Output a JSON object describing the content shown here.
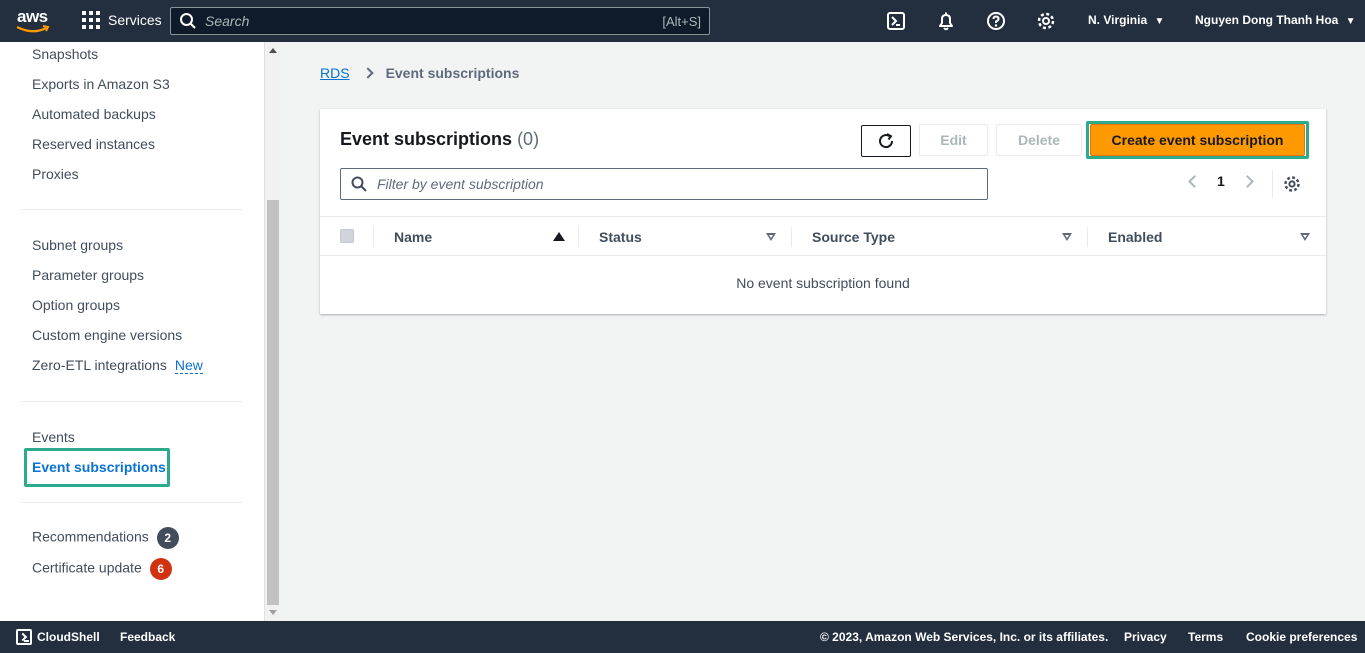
{
  "topnav": {
    "logo": "aws",
    "services_label": "Services",
    "search_placeholder": "Search",
    "search_shortcut": "[Alt+S]",
    "region": "N. Virginia",
    "user": "Nguyen Dong Thanh Hoa",
    "icons": [
      "cloudshell-icon",
      "notifications-icon",
      "help-icon",
      "settings-icon"
    ]
  },
  "sidebar": {
    "group1": [
      "Snapshots",
      "Exports in Amazon S3",
      "Automated backups",
      "Reserved instances",
      "Proxies"
    ],
    "group2": [
      "Subnet groups",
      "Parameter groups",
      "Option groups",
      "Custom engine versions",
      "Zero-ETL integrations"
    ],
    "new_label": "New",
    "group3": [
      "Events",
      "Event subscriptions"
    ],
    "group4": [
      {
        "label": "Recommendations",
        "count": "2"
      },
      {
        "label": "Certificate update",
        "count": "6"
      }
    ]
  },
  "breadcrumb": {
    "root": "RDS",
    "current": "Event subscriptions"
  },
  "panel": {
    "title": "Event subscriptions",
    "count": "(0)",
    "edit_label": "Edit",
    "delete_label": "Delete",
    "create_label": "Create event subscription",
    "filter_placeholder": "Filter by event subscription",
    "page_number": "1",
    "columns": [
      "Name",
      "Status",
      "Source Type",
      "Enabled"
    ],
    "empty_message": "No event subscription found"
  },
  "footer": {
    "cloudshell": "CloudShell",
    "feedback": "Feedback",
    "copyright": "© 2023, Amazon Web Services, Inc. or its affiliates.",
    "privacy": "Privacy",
    "terms": "Terms",
    "cookies": "Cookie preferences"
  },
  "colors": {
    "nav_bg": "#232f3e",
    "accent_orange": "#ff9900",
    "link_blue": "#0972d3",
    "highlight_green": "#2cab8c",
    "badge_red": "#d13212"
  }
}
